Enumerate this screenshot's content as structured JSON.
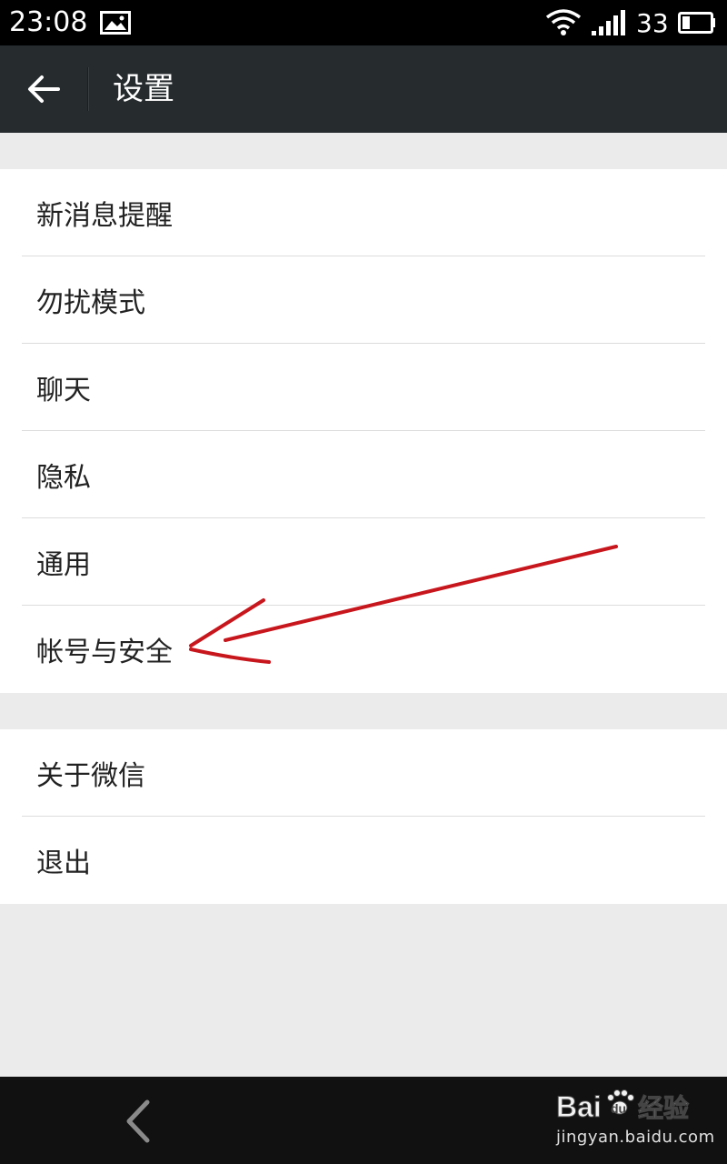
{
  "status_bar": {
    "time": "23:08",
    "battery_level": "33",
    "icons": [
      "image-icon",
      "wifi-icon",
      "signal-icon",
      "battery-icon"
    ]
  },
  "app_bar": {
    "title": "设置",
    "back_icon": "back-arrow-icon"
  },
  "settings": {
    "group1": [
      {
        "label": "新消息提醒"
      },
      {
        "label": "勿扰模式"
      },
      {
        "label": "聊天"
      },
      {
        "label": "隐私"
      },
      {
        "label": "通用"
      },
      {
        "label": "帐号与安全"
      }
    ],
    "group2": [
      {
        "label": "关于微信"
      },
      {
        "label": "退出"
      }
    ]
  },
  "nav_bar": {
    "back_icon": "nav-back-icon"
  },
  "watermark": {
    "logo_text": "Bai  经验",
    "url": "jingyan.baidu.com"
  },
  "colors": {
    "app_bar_bg": "#262b2e",
    "page_bg": "#ebebeb",
    "annotation": "#c8161d"
  }
}
